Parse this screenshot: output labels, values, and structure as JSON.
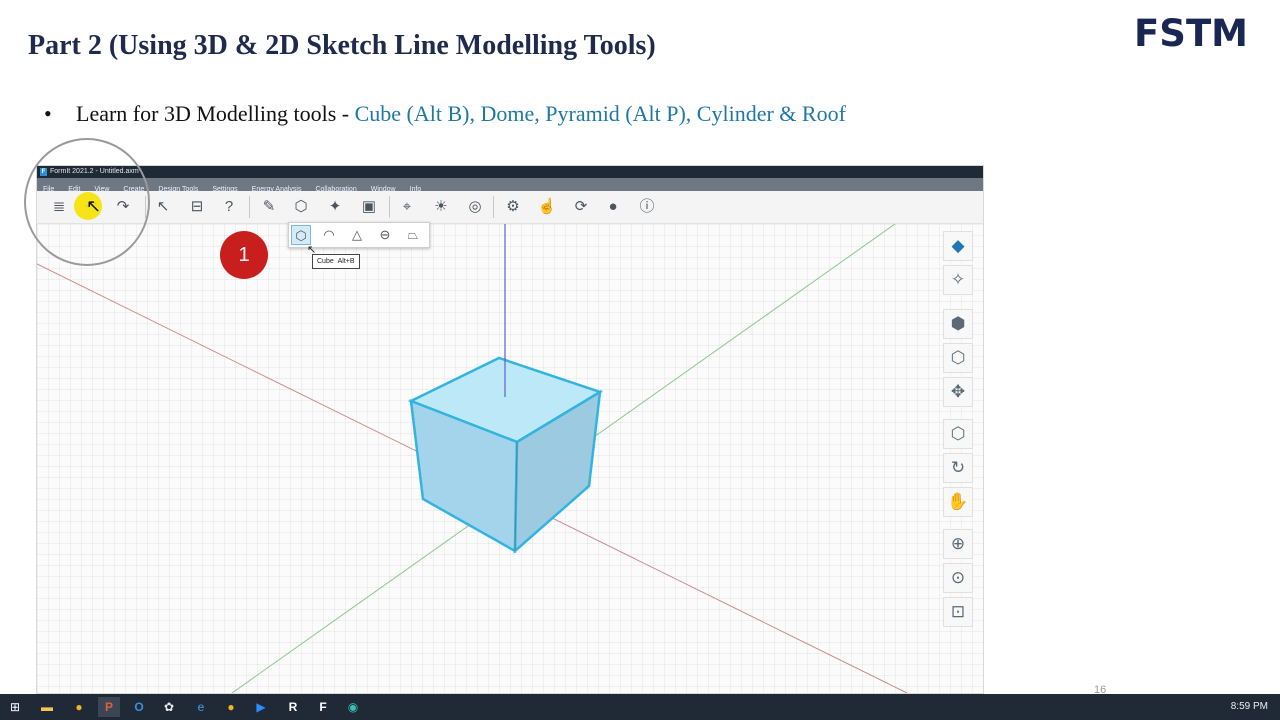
{
  "slide": {
    "title": "Part 2  (Using 3D & 2D Sketch Line Modelling Tools)",
    "logo": "FSTM",
    "bullet_marker": "•",
    "bullet_text": "Learn for 3D Modelling tools - ",
    "bullet_highlight": "Cube (Alt B), Dome, Pyramid (Alt P), Cylinder & Roof",
    "highlight_color": "#1f77a8",
    "step_number": "1",
    "page_number": "16"
  },
  "app": {
    "window_title": "FormIt 2021.2 - Untitled.axm*",
    "menu": [
      "File",
      "Edit",
      "View",
      "Create",
      "Design Tools",
      "Settings",
      "Energy Analysis",
      "Collaboration",
      "Window",
      "Info"
    ],
    "toolbar_icons": [
      "layers-icon",
      "undo-icon",
      "redo-icon",
      "select-icon",
      "measure-icon",
      "tape-icon",
      "sketch-icon",
      "solid-create-icon",
      "edit-solid-icon",
      "group-icon",
      "location-icon",
      "sun-icon",
      "view-360-icon",
      "settings-icon",
      "touch-icon",
      "share-icon",
      "user-icon",
      "info-icon"
    ],
    "flyout_items": [
      "cube-icon",
      "dome-icon",
      "pyramid-icon",
      "cylinder-icon",
      "roof-icon"
    ],
    "tooltip": {
      "name": "Cube",
      "shortcut": "Alt+B"
    },
    "right_nav_icons": [
      "view-cube-icon",
      "visual-style-icon",
      "perspective-icon",
      "orthographic-icon",
      "walk-icon",
      "iso-view-icon",
      "orbit-icon",
      "pan-icon",
      "zoom-icon",
      "zoom-extents-icon",
      "zoom-selected-icon"
    ],
    "cube_color": "#a9d9ee",
    "cube_edge_color": "#31b4df"
  },
  "taskbar": {
    "apps": [
      "windows-start-icon",
      "file-explorer-icon",
      "chrome-icon",
      "powerpoint-icon",
      "outlook-icon",
      "paint-icon",
      "edge-icon",
      "chrome-icon-2",
      "zoom-icon",
      "revit-icon",
      "formit-icon",
      "edge-beta-icon"
    ],
    "time": "8:59 PM"
  }
}
